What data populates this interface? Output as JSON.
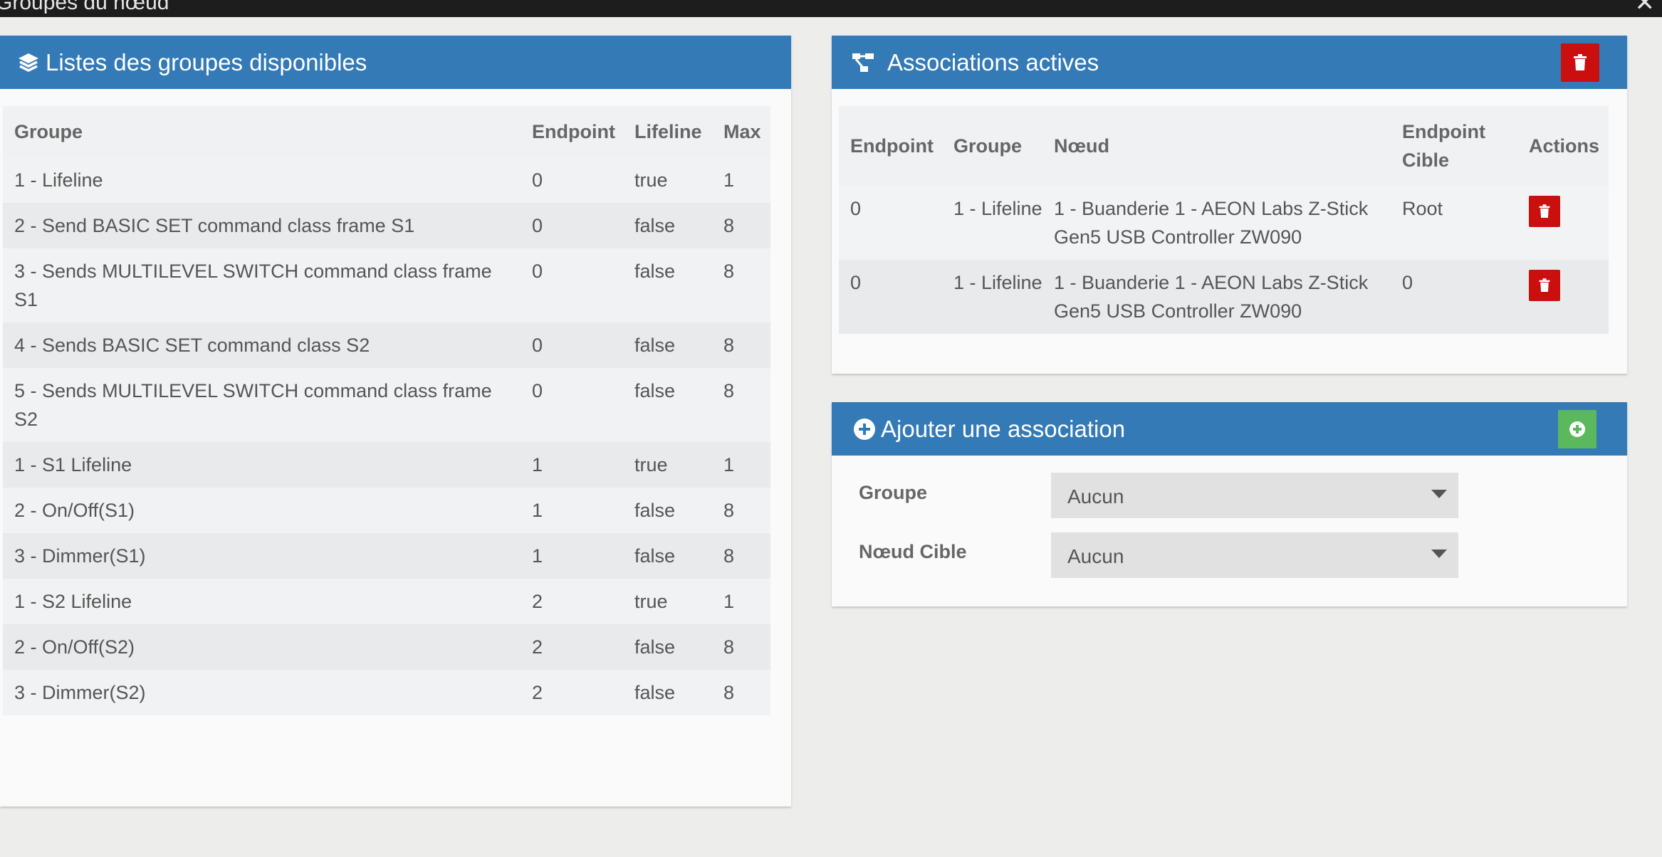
{
  "window": {
    "title": "Groupes du nœud",
    "close_glyph": "✕"
  },
  "groups_panel": {
    "title": "Listes des groupes disponibles",
    "icon": "layers-icon",
    "columns": [
      "Groupe",
      "Endpoint",
      "Lifeline",
      "Max"
    ],
    "rows": [
      [
        "1 - Lifeline",
        "0",
        "true",
        "1"
      ],
      [
        "2 - Send BASIC SET command class frame S1",
        "0",
        "false",
        "8"
      ],
      [
        "3 - Sends MULTILEVEL SWITCH command class frame S1",
        "0",
        "false",
        "8"
      ],
      [
        "4 - Sends BASIC SET command class S2",
        "0",
        "false",
        "8"
      ],
      [
        "5 - Sends MULTILEVEL SWITCH command class frame S2",
        "0",
        "false",
        "8"
      ],
      [
        "1 - S1 Lifeline",
        "1",
        "true",
        "1"
      ],
      [
        "2 - On/Off(S1)",
        "1",
        "false",
        "8"
      ],
      [
        "3 - Dimmer(S1)",
        "1",
        "false",
        "8"
      ],
      [
        "1 - S2 Lifeline",
        "2",
        "true",
        "1"
      ],
      [
        "2 - On/Off(S2)",
        "2",
        "false",
        "8"
      ],
      [
        "3 - Dimmer(S2)",
        "2",
        "false",
        "8"
      ]
    ]
  },
  "assoc_panel": {
    "title": "Associations actives",
    "icon": "network-icon",
    "columns": [
      "Endpoint",
      "Groupe",
      "Nœud",
      "Endpoint Cible",
      "Actions"
    ],
    "rows": [
      [
        "0",
        "1 - Lifeline",
        "1 - Buanderie 1 - AEON Labs Z-Stick Gen5 USB Controller ZW090",
        "Root"
      ],
      [
        "0",
        "1 - Lifeline",
        "1 - Buanderie 1 - AEON Labs Z-Stick Gen5 USB Controller ZW090",
        "0"
      ]
    ]
  },
  "add_panel": {
    "title": "Ajouter une association",
    "icon": "plus-circle-icon",
    "group_label": "Groupe",
    "group_value": "Aucun",
    "target_label": "Nœud Cible",
    "target_value": "Aucun"
  },
  "colors": {
    "panel_header": "#337ab7",
    "danger": "#c9100f",
    "success": "#5cb85c",
    "background": "#ededeb"
  }
}
